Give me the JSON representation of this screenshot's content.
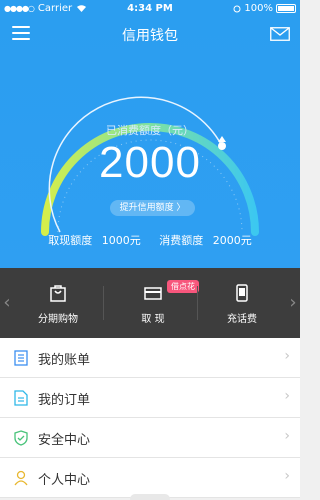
{
  "status_bar": {
    "signal_dots": "●●●●○",
    "carrier": "Carrier",
    "wifi_icon": "wifi-icon",
    "time": "4:34 PM",
    "battery_text": "100%"
  },
  "header": {
    "title": "信用钱包",
    "menu_icon": "menu-icon",
    "mail_icon": "mail-icon"
  },
  "gauge": {
    "label": "已消费额度（元）",
    "value": "2000",
    "raise_button": "提升信用额度 〉",
    "available_label": "取现额度",
    "available_value": "1000元",
    "consumed_label": "消费额度",
    "consumed_value": "2000元",
    "colors": {
      "start": "#d5ee4b",
      "mid": "#7ee1a1",
      "end": "#3cc8f0",
      "track": "#8cc8f5"
    }
  },
  "shortcuts": [
    {
      "label": "分期购物",
      "icon": "shopping-bag-icon"
    },
    {
      "label": "取 现",
      "icon": "card-icon",
      "badge": "借点花"
    },
    {
      "label": "充话费",
      "icon": "phone-icon"
    }
  ],
  "menu": [
    {
      "label": "我的账单",
      "icon": "bill-icon",
      "color": "#3b8ff0"
    },
    {
      "label": "我的订单",
      "icon": "order-icon",
      "color": "#2fb8e8"
    },
    {
      "label": "安全中心",
      "icon": "shield-icon",
      "color": "#49c37a"
    },
    {
      "label": "个人中心",
      "icon": "user-icon",
      "color": "#e8b72f"
    }
  ]
}
